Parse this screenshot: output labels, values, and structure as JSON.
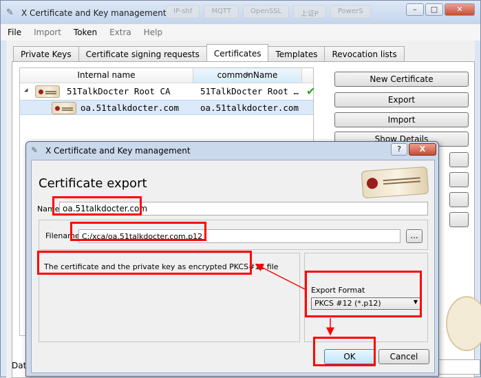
{
  "window": {
    "title": "X Certificate and Key management",
    "bg_tabs": [
      "IP-shf",
      "MQTT",
      "OpenSSL",
      "上证P",
      "PowerS"
    ]
  },
  "menu": [
    {
      "label": "File",
      "enabled": true
    },
    {
      "label": "Import",
      "enabled": false
    },
    {
      "label": "Token",
      "enabled": true
    },
    {
      "label": "Extra",
      "enabled": false
    },
    {
      "label": "Help",
      "enabled": false
    }
  ],
  "tabs": [
    {
      "label": "Private Keys"
    },
    {
      "label": "Certificate signing requests"
    },
    {
      "label": "Certificates",
      "active": true
    },
    {
      "label": "Templates"
    },
    {
      "label": "Revocation lists"
    }
  ],
  "tree": {
    "columns": [
      "Internal name",
      "commonName"
    ],
    "rows": [
      {
        "name": "51TalkDocter Root CA",
        "cn": "51TalkDocter Root …",
        "trusted": true
      },
      {
        "name": "oa.51talkdocter.com",
        "cn": "oa.51talkdocter.com",
        "selected": true
      }
    ]
  },
  "side_buttons": [
    "New Certificate",
    "Export",
    "Import",
    "Show Details"
  ],
  "bottom_label": "Dat",
  "dialog": {
    "title": "X Certificate and Key management",
    "help": "?",
    "close": "X",
    "heading": "Certificate export",
    "name_label": "Name",
    "name_value": "oa.51talkdocter.com",
    "filename_label": "Filename",
    "filename_value": "C:/xca/oa.51talkdocter.com.p12",
    "browse": "...",
    "description": "The certificate and the private key as encrypted PKCS#12 file",
    "format_label": "Export Format",
    "format_value": "PKCS #12 (*.p12)",
    "ok": "OK",
    "cancel": "Cancel"
  },
  "colors": {
    "highlight": "#ff0000",
    "accent": "#3c7fb1"
  }
}
